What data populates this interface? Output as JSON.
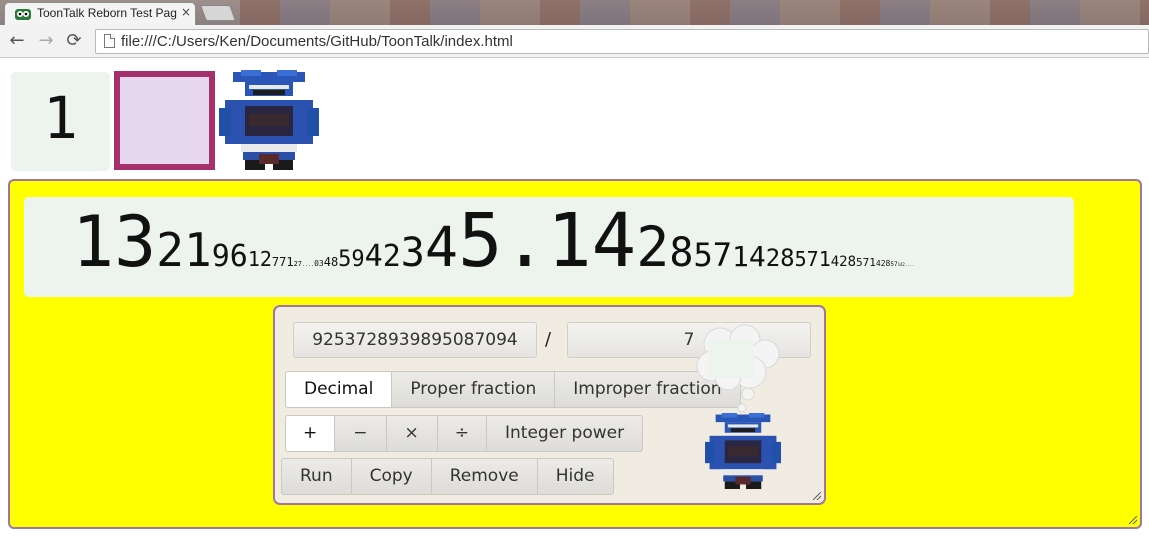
{
  "browser": {
    "tab_title": "ToonTalk Reborn Test Pag",
    "tab_close": "×",
    "url": "file:///C:/Users/Ken/Documents/GitHub/ToonTalk/index.html",
    "back_icon": "←",
    "forward_icon": "→",
    "reload_icon": "⟳"
  },
  "widgets": {
    "small_number": "1",
    "box_color": "#a5306b"
  },
  "big_number": {
    "digit_groups": [
      {
        "text": "13",
        "size": 70
      },
      {
        "text": "21",
        "size": 46
      },
      {
        "text": "96",
        "size": 30
      },
      {
        "text": "12",
        "size": 20
      },
      {
        "text": "771",
        "size": 12
      },
      {
        "text": "27",
        "size": 7
      },
      {
        "text": "....",
        "size": 5
      },
      {
        "text": "03",
        "size": 8
      },
      {
        "text": "48",
        "size": 12
      },
      {
        "text": "59",
        "size": 22
      },
      {
        "text": "42",
        "size": 30
      },
      {
        "text": "3",
        "size": 40
      },
      {
        "text": "4",
        "size": 55
      },
      {
        "text": "5.14",
        "size": 74
      },
      {
        "text": "2",
        "size": 55
      },
      {
        "text": "8",
        "size": 40
      },
      {
        "text": "57",
        "size": 32
      },
      {
        "text": "14",
        "size": 28
      },
      {
        "text": "28",
        "size": 24
      },
      {
        "text": "571",
        "size": 20
      },
      {
        "text": "428",
        "size": 14
      },
      {
        "text": "571",
        "size": 11
      },
      {
        "text": "428",
        "size": 8
      },
      {
        "text": "57",
        "size": 6
      },
      {
        "text": "142....",
        "size": 4
      }
    ]
  },
  "dialog": {
    "numerator": "925372893989508 7094",
    "numerator_display": "9253728939895087094",
    "slash": "/",
    "denominator": "7",
    "format_buttons": [
      "Decimal",
      "Proper fraction",
      "Improper fraction"
    ],
    "operator_buttons": [
      "+",
      "−",
      "×",
      "÷",
      "Integer power"
    ],
    "action_buttons": [
      "Run",
      "Copy",
      "Remove",
      "Hide"
    ]
  }
}
